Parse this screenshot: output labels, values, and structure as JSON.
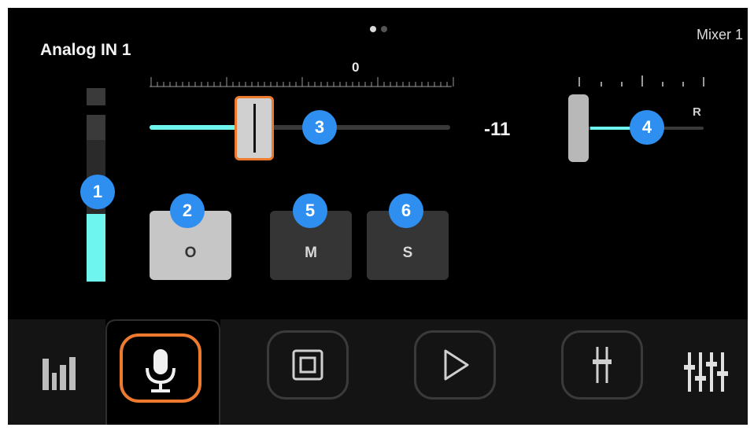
{
  "header": {
    "channel_name": "Analog IN 1",
    "mixer_label": "Mixer 1",
    "page_indicator": {
      "pages": 2,
      "current": 1
    }
  },
  "meter": {
    "level": 0.48,
    "fill_color": "#6ff5f0"
  },
  "fader": {
    "scale_zero_label": "0",
    "value_text": "-11",
    "accent_color": "#ee7a2e",
    "fill_color": "#6ff5f0"
  },
  "pan": {
    "right_label": "R"
  },
  "buttons": {
    "phase_label": "O",
    "mute_label": "M",
    "solo_label": "S"
  },
  "callouts": [
    "1",
    "2",
    "3",
    "4",
    "5",
    "6"
  ],
  "nav": {
    "items": [
      {
        "icon": "bar-chart-icon"
      },
      {
        "icon": "microphone-icon",
        "active": true
      },
      {
        "icon": "square-frame-icon"
      },
      {
        "icon": "play-icon"
      },
      {
        "icon": "fader-icon"
      },
      {
        "icon": "mixer-sliders-icon"
      }
    ]
  }
}
